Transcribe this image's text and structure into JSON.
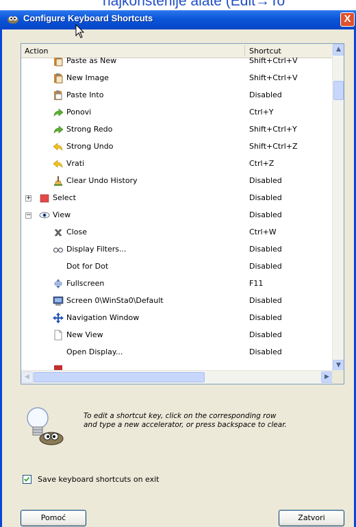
{
  "background_text": "najkorištenije alate (Edit→To",
  "window": {
    "title": "Configure Keyboard Shortcuts",
    "close_label": "X"
  },
  "columns": {
    "action": "Action",
    "shortcut": "Shortcut"
  },
  "rows": [
    {
      "name": "Paste as New",
      "shortcut": "Shift+Ctrl+V",
      "icon": "paste-as-new-icon"
    },
    {
      "name": "New Image",
      "shortcut": "Shift+Ctrl+V",
      "icon": "new-image-icon"
    },
    {
      "name": "Paste Into",
      "shortcut": "Disabled",
      "icon": "paste-into-icon"
    },
    {
      "name": "Ponovi",
      "shortcut": "Ctrl+Y",
      "icon": "redo-icon"
    },
    {
      "name": "Strong Redo",
      "shortcut": "Shift+Ctrl+Y",
      "icon": "strong-redo-icon"
    },
    {
      "name": "Strong Undo",
      "shortcut": "Shift+Ctrl+Z",
      "icon": "strong-undo-icon"
    },
    {
      "name": "Vrati",
      "shortcut": "Ctrl+Z",
      "icon": "undo-icon"
    },
    {
      "name": "Clear Undo History",
      "shortcut": "Disabled",
      "icon": "clear-history-icon"
    },
    {
      "name": "Select",
      "shortcut": "Disabled",
      "icon": "select-icon",
      "group": "collapsed"
    },
    {
      "name": "View",
      "shortcut": "Disabled",
      "icon": "view-eye-icon",
      "group": "expanded"
    },
    {
      "name": "Close",
      "shortcut": "Ctrl+W",
      "icon": "close-x-icon"
    },
    {
      "name": "Display Filters...",
      "shortcut": "Disabled",
      "icon": "display-filters-icon"
    },
    {
      "name": "Dot for Dot",
      "shortcut": "Disabled",
      "icon": ""
    },
    {
      "name": "Fullscreen",
      "shortcut": "F11",
      "icon": "fullscreen-icon"
    },
    {
      "name": "Screen 0\\WinSta0\\Default",
      "shortcut": "Disabled",
      "icon": "screen-icon"
    },
    {
      "name": "Navigation Window",
      "shortcut": "Disabled",
      "icon": "navigation-icon"
    },
    {
      "name": "New View",
      "shortcut": "Disabled",
      "icon": "new-view-icon"
    },
    {
      "name": "Open Display...",
      "shortcut": "Disabled",
      "icon": ""
    }
  ],
  "hint": {
    "line1": "To edit a shortcut key, click on the corresponding row",
    "line2": "and type a new accelerator, or press backspace to clear."
  },
  "save_on_exit": {
    "label": "Save keyboard shortcuts on exit",
    "checked": true
  },
  "buttons": {
    "help": "Pomoć",
    "close": "Zatvori"
  }
}
